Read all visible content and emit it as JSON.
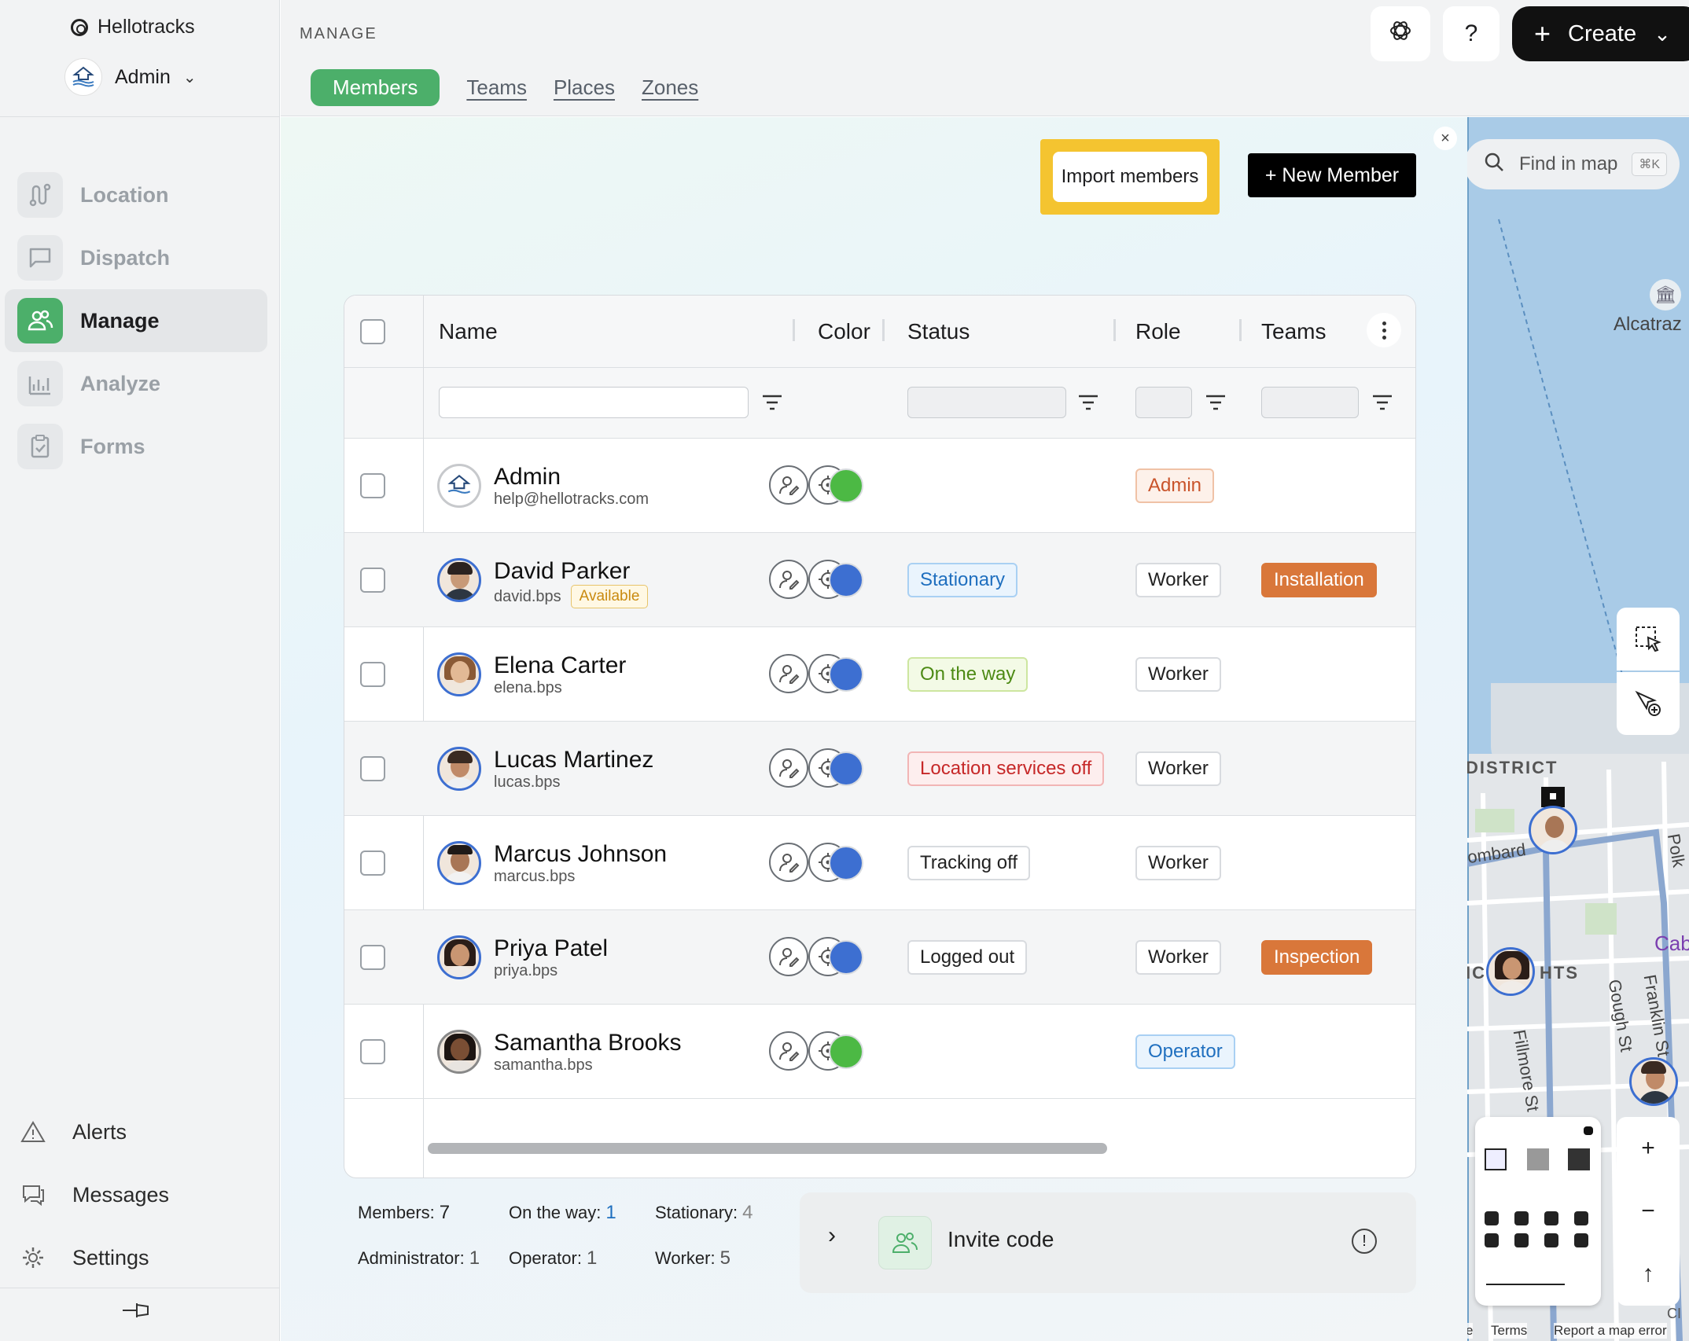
{
  "app": {
    "brand": "Hellotracks",
    "org_name": "Admin"
  },
  "sidebar": {
    "items": [
      {
        "label": "Location",
        "icon": "route-icon"
      },
      {
        "label": "Dispatch",
        "icon": "dispatch-icon"
      },
      {
        "label": "Manage",
        "icon": "people-icon",
        "active": true
      },
      {
        "label": "Analyze",
        "icon": "chart-icon"
      },
      {
        "label": "Forms",
        "icon": "clipboard-icon"
      }
    ],
    "bottom": [
      {
        "label": "Alerts",
        "icon": "warning-icon"
      },
      {
        "label": "Messages",
        "icon": "message-icon"
      },
      {
        "label": "Settings",
        "icon": "gear-icon"
      }
    ]
  },
  "header": {
    "section": "MANAGE",
    "tabs": [
      "Members",
      "Teams",
      "Places",
      "Zones"
    ],
    "active_tab": "Members",
    "help_label": "?",
    "create_label": "Create"
  },
  "toolbar": {
    "import_label": "Import members",
    "new_member_label": "+ New Member"
  },
  "table": {
    "columns": [
      "Name",
      "Color",
      "Status",
      "Role",
      "Teams"
    ],
    "rows": [
      {
        "name": "Admin",
        "sub": "help@hellotracks.com",
        "avail": "",
        "color": "#4cb944",
        "status": "",
        "role": "Admin",
        "team": ""
      },
      {
        "name": "David Parker",
        "sub": "david.bps",
        "avail": "Available",
        "color": "#3d6fd1",
        "status": "Stationary",
        "role": "Worker",
        "team": "Installation"
      },
      {
        "name": "Elena Carter",
        "sub": "elena.bps",
        "avail": "",
        "color": "#3d6fd1",
        "status": "On the way",
        "role": "Worker",
        "team": ""
      },
      {
        "name": "Lucas Martinez",
        "sub": "lucas.bps",
        "avail": "",
        "color": "#3d6fd1",
        "status": "Location services off",
        "role": "Worker",
        "team": ""
      },
      {
        "name": "Marcus Johnson",
        "sub": "marcus.bps",
        "avail": "",
        "color": "#3d6fd1",
        "status": "Tracking off",
        "role": "Worker",
        "team": ""
      },
      {
        "name": "Priya Patel",
        "sub": "priya.bps",
        "avail": "",
        "color": "#3d6fd1",
        "status": "Logged out",
        "role": "Worker",
        "team": "Inspection"
      },
      {
        "name": "Samantha Brooks",
        "sub": "samantha.bps",
        "avail": "",
        "color": "#4cb944",
        "status": "",
        "role": "Operator",
        "team": ""
      }
    ]
  },
  "stats": {
    "members_label": "Members:",
    "members": "7",
    "ontheway_label": "On the way:",
    "ontheway": "1",
    "stationary_label": "Stationary:",
    "stationary": "4",
    "admin_label": "Administrator:",
    "admin": "1",
    "operator_label": "Operator:",
    "operator": "1",
    "worker_label": "Worker:",
    "worker": "5"
  },
  "invite": {
    "label": "Invite code"
  },
  "map": {
    "search_placeholder": "Find in map",
    "shortcut": "⌘K",
    "labels": [
      "Alcatraz",
      "DISTRICT",
      "ombard",
      "Cab",
      "IC",
      "HTS",
      "Fillmore St",
      "Gough St",
      "Franklin St",
      "Polk",
      "CI"
    ],
    "footer": [
      "e",
      "Terms",
      "Report a map error"
    ]
  }
}
